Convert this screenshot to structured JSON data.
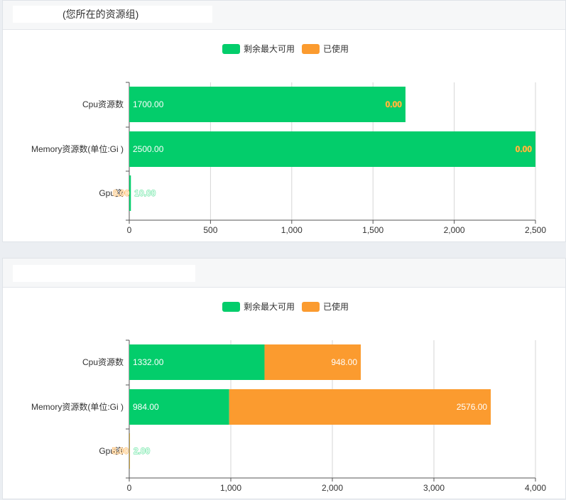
{
  "legend": {
    "remaining": "剩余最大可用",
    "used": "已使用"
  },
  "colors": {
    "remaining": "#03cd6b",
    "used": "#fb9b2f",
    "remaining_label": "#ffd94a",
    "used_label": "#3fd887"
  },
  "panels": [
    {
      "title": "(您所在的资源组)"
    },
    {
      "title": ""
    }
  ],
  "chart_data": [
    {
      "type": "bar",
      "orientation": "horizontal",
      "stacked": true,
      "categories": [
        "Cpu资源数",
        "Memory资源数(单位:Gi )",
        "Gpu资源数"
      ],
      "category_display": [
        "Cpu资源数",
        "Memory资源数(单位:Gi )",
        "Gpu资"
      ],
      "series": [
        {
          "name": "剩余最大可用",
          "values": [
            1700.0,
            2500.0,
            10.0
          ],
          "labels": [
            "1700.00",
            "2500.00",
            "10.00"
          ]
        },
        {
          "name": "已使用",
          "values": [
            0.0,
            0.0,
            0.0
          ],
          "labels": [
            "0.00",
            "0.00",
            "0.00"
          ]
        }
      ],
      "xlim": [
        0,
        2500
      ],
      "ticks": [
        "0",
        "500",
        "1,000",
        "1,500",
        "2,000",
        "2,500"
      ],
      "grid": true,
      "legend_position": "top-center"
    },
    {
      "type": "bar",
      "orientation": "horizontal",
      "stacked": true,
      "categories": [
        "Cpu资源数",
        "Memory资源数(单位:Gi )",
        "Gpu资源数"
      ],
      "category_display": [
        "Cpu资源数",
        "Memory资源数(单位:Gi )",
        "Gpu资"
      ],
      "series": [
        {
          "name": "剩余最大可用",
          "values": [
            1332.0,
            984.0,
            2.0
          ],
          "labels": [
            "1332.00",
            "984.00",
            "2.00"
          ]
        },
        {
          "name": "已使用",
          "values": [
            948.0,
            2576.0,
            5.0
          ],
          "labels": [
            "948.00",
            "2576.00",
            "5.00"
          ]
        }
      ],
      "xlim": [
        0,
        4000
      ],
      "ticks": [
        "0",
        "1,000",
        "2,000",
        "3,000",
        "4,000"
      ],
      "grid": true,
      "legend_position": "top-center"
    }
  ]
}
